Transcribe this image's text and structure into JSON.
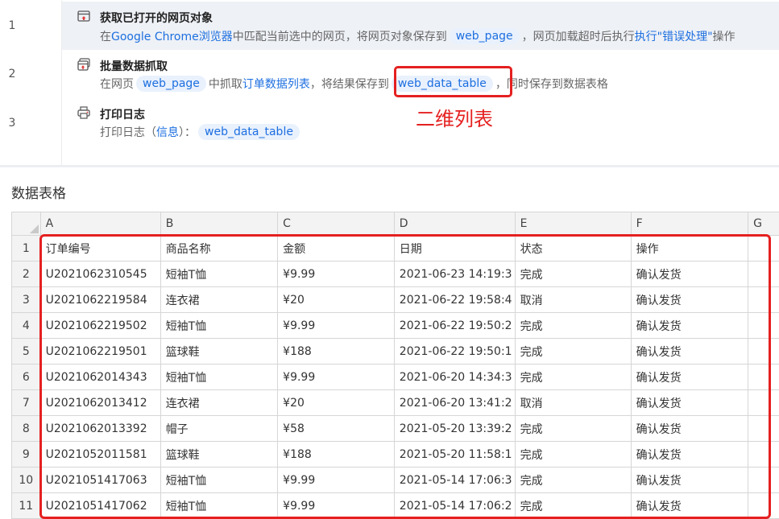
{
  "steps": [
    {
      "num": "1",
      "title": "获取已打开的网页对象",
      "icon": "browser-window-icon",
      "desc": {
        "prefix": "在",
        "link_browser": "Google Chrome浏览器",
        "mid1": "中匹配当前选中的网页，将网页对象保存到",
        "chip_var": "web_page",
        "mid2": "，网页加载超时后执行",
        "link_action": "执行\"错误处理\"",
        "suffix": "操作"
      }
    },
    {
      "num": "2",
      "title": "批量数据抓取",
      "icon": "batch-grab-icon",
      "desc": {
        "prefix": "在网页",
        "chip_page": "web_page",
        "mid1": "中抓取",
        "link_list": "订单数据列表",
        "mid2": "，将结果保存到",
        "chip_var": "web_data_table",
        "suffix": "，同时保存到数据表格"
      }
    },
    {
      "num": "3",
      "title": "打印日志",
      "icon": "printer-icon",
      "desc": {
        "prefix": "打印日志（",
        "link_level": "信息",
        "mid1": "）：",
        "chip_var": "web_data_table"
      }
    }
  ],
  "annotation": "二维列表",
  "table_section": {
    "title": "数据表格",
    "columns": [
      "A",
      "B",
      "C",
      "D",
      "E",
      "F",
      "G"
    ],
    "rows": [
      [
        "订单编号",
        "商品名称",
        "金额",
        "日期",
        "状态",
        "操作"
      ],
      [
        "U2021062310545",
        "短袖T恤",
        "¥9.99",
        "2021-06-23 14:19:3",
        "完成",
        "确认发货"
      ],
      [
        "U2021062219584",
        "连衣裙",
        "¥20",
        "2021-06-22 19:58:4",
        "取消",
        "确认发货"
      ],
      [
        "U2021062219502",
        "短袖T恤",
        "¥9.99",
        "2021-06-22 19:50:2",
        "完成",
        "确认发货"
      ],
      [
        "U2021062219501",
        "篮球鞋",
        "¥188",
        "2021-06-22 19:50:1",
        "完成",
        "确认发货"
      ],
      [
        "U2021062014343",
        "短袖T恤",
        "¥9.99",
        "2021-06-20 14:34:3",
        "完成",
        "确认发货"
      ],
      [
        "U2021062013412",
        "连衣裙",
        "¥20",
        "2021-06-20 13:41:2",
        "取消",
        "确认发货"
      ],
      [
        "U2021062013392",
        "帽子",
        "¥58",
        "2021-05-20 13:39:2",
        "完成",
        "确认发货"
      ],
      [
        "U2021052011581",
        "篮球鞋",
        "¥188",
        "2021-05-20 11:58:1",
        "完成",
        "确认发货"
      ],
      [
        "U2021051417063",
        "短袖T恤",
        "¥9.99",
        "2021-05-14 17:06:3",
        "完成",
        "确认发货"
      ],
      [
        "U2021051417062",
        "短袖T恤",
        "¥9.99",
        "2021-05-14 17:06:2",
        "完成",
        "确认发货"
      ]
    ]
  },
  "colors": {
    "accent": "#1d6fe0",
    "chip_bg": "#e9f1fd",
    "annotation_red": "#e52020",
    "selected_row": "#eef1f6"
  }
}
